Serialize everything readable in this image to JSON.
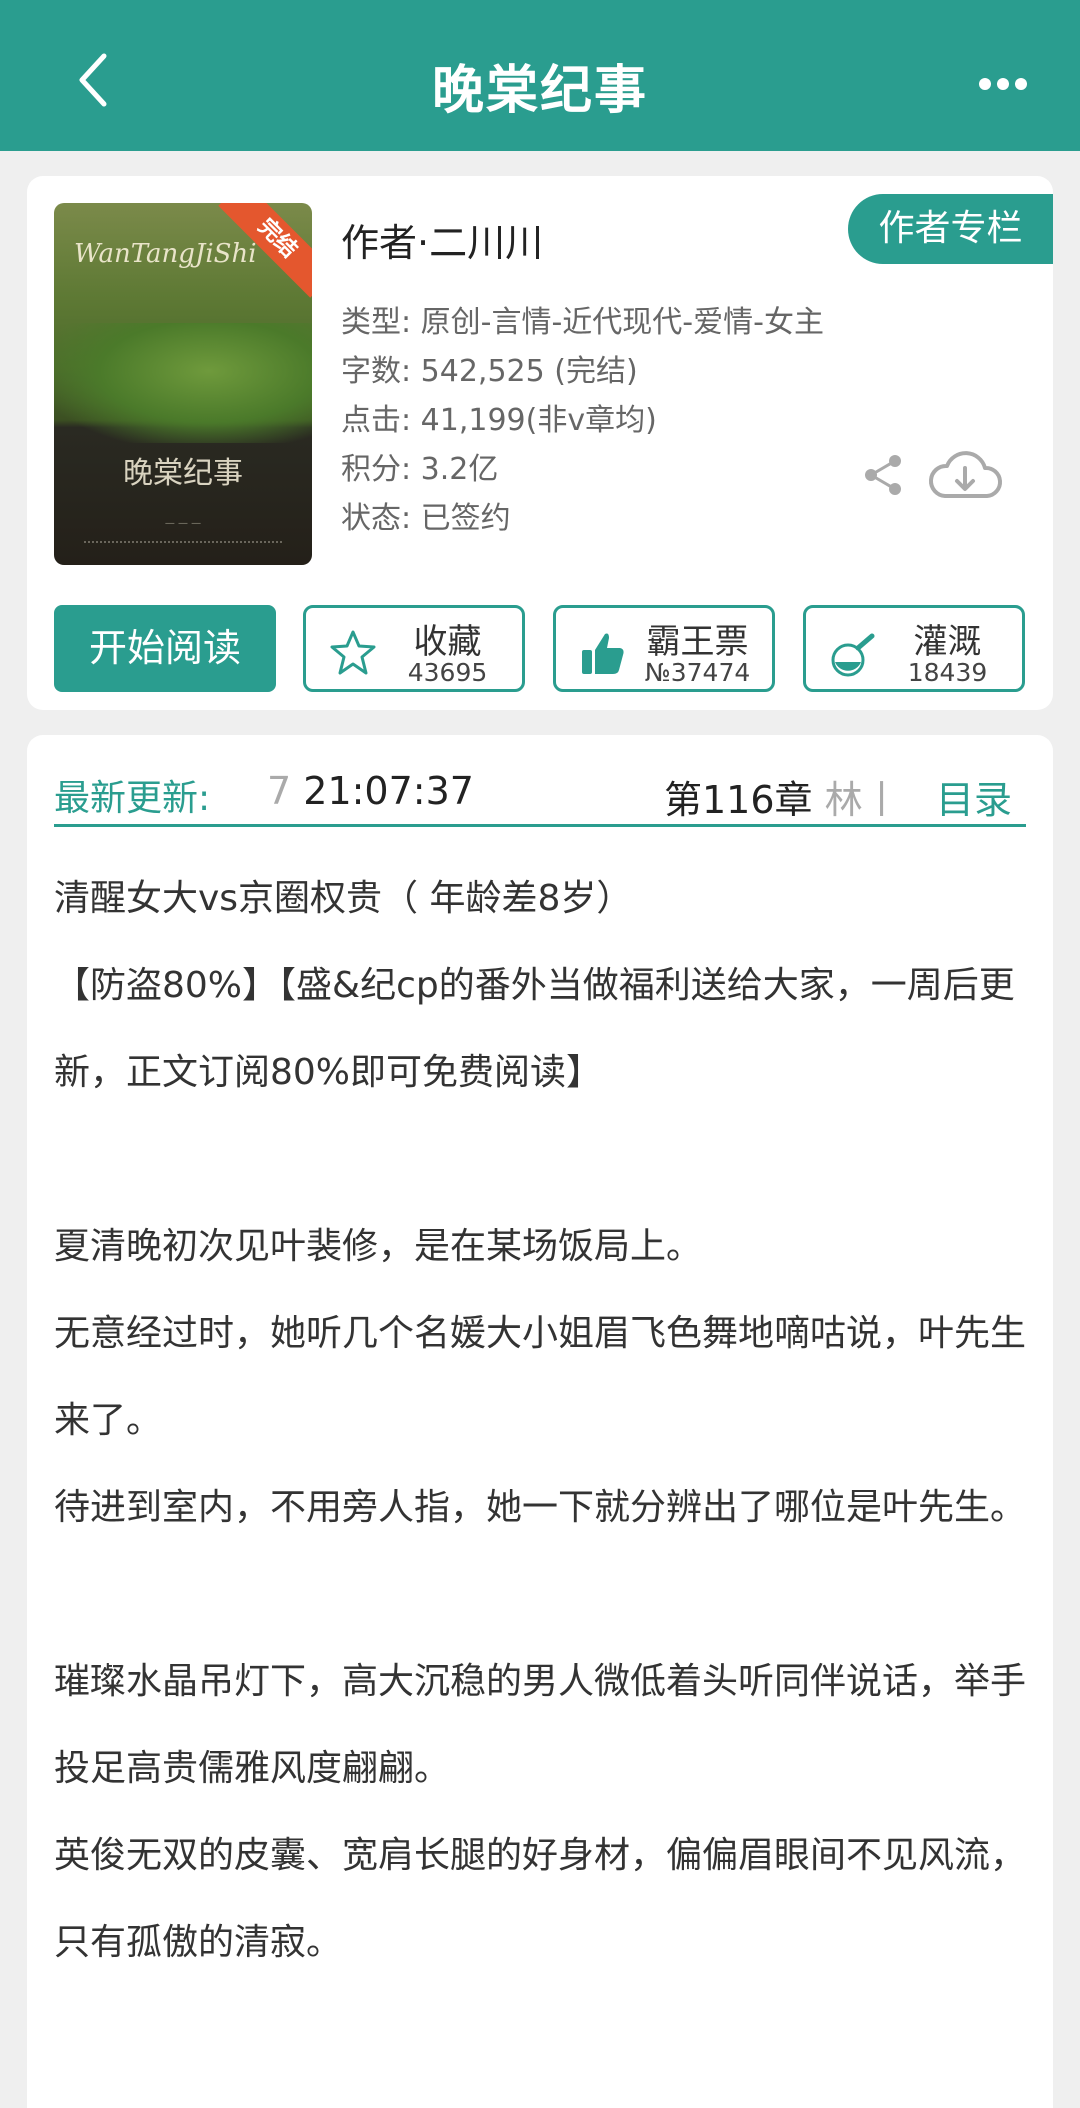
{
  "header": {
    "title": "晚棠纪事",
    "back_icon": "chevron-left-icon",
    "more_icon": "more-dots-icon"
  },
  "book": {
    "cover": {
      "script_title": "WanTangJiShi",
      "cn_title": "晚棠纪事",
      "badge": "完结"
    },
    "author": "作者·二川川",
    "author_column_label": "作者专栏",
    "meta": [
      "类型: 原创-言情-近代现代-爱情-女主",
      "字数: 542,525 (完结)",
      "点击: 41,199(非v章均)",
      "积分: 3.2亿",
      "状态: 已签约"
    ]
  },
  "actions": {
    "read_label": "开始阅读",
    "stats": [
      {
        "label": "收藏",
        "value": "43695",
        "icon": "star-icon"
      },
      {
        "label": "霸王票",
        "value": "№37474",
        "icon": "thumbs-up-icon"
      },
      {
        "label": "灌溉",
        "value": "18439",
        "icon": "watering-flask-icon"
      }
    ]
  },
  "update": {
    "label": "最新更新:",
    "time_faded": "7",
    "time": " 21:07:37",
    "chapter": "第116章 ",
    "chapter_faded": "林丨",
    "toc_label": "目录"
  },
  "description": [
    "清醒女大vs京圈权贵（ 年龄差8岁）",
    "【防盗80%】【盛&纪cp的番外当做福利送给大家，一周后更新，正文订阅80%即可免费阅读】",
    "",
    "夏清晚初次见叶裴修，是在某场饭局上。",
    "无意经过时，她听几个名媛大小姐眉飞色舞地嘀咕说，叶先生来了。",
    "待进到室内，不用旁人指，她一下就分辨出了哪位是叶先生。",
    "",
    "璀璨水晶吊灯下，高大沉稳的男人微低着头听同伴说话，举手投足高贵儒雅风度翩翩。",
    "英俊无双的皮囊、宽肩长腿的好身材，偏偏眉眼间不见风流，只有孤傲的清寂。"
  ],
  "colors": {
    "accent": "#2a9d8f",
    "badge": "#e4572e"
  }
}
